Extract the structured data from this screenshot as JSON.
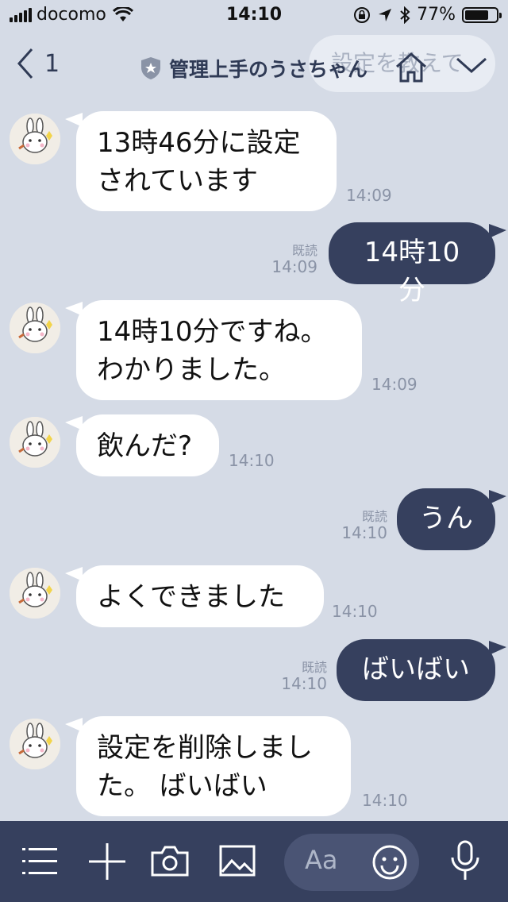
{
  "status_bar": {
    "carrier": "docomo",
    "time": "14:10",
    "battery_percent": "77%",
    "battery_level": 0.77
  },
  "header": {
    "back_count": "1",
    "title": "管理上手のうさちゃん",
    "ghost_text": "設定を教えて"
  },
  "messages": [
    {
      "side": "in",
      "text_lines": [
        "13時46分に設定",
        "されています"
      ],
      "time": "14:09"
    },
    {
      "side": "out",
      "text": "14時10分",
      "read": "既読",
      "time": "14:09"
    },
    {
      "side": "in",
      "text_lines": [
        "14時10分ですね。",
        "わかりました。"
      ],
      "time": "14:09"
    },
    {
      "side": "in",
      "text": "飲んだ?",
      "time": "14:10"
    },
    {
      "side": "out",
      "text": "うん",
      "read": "既読",
      "time": "14:10"
    },
    {
      "side": "in",
      "text": "よくできました",
      "time": "14:10"
    },
    {
      "side": "out",
      "text": "ばいばい",
      "read": "既読",
      "time": "14:10"
    },
    {
      "side": "in",
      "text_lines": [
        "設定を削除しまし",
        "た。 ばいばい"
      ],
      "time": "14:10"
    }
  ],
  "composer": {
    "placeholder": "Aa",
    "icons": [
      "menu-icon",
      "plus-icon",
      "camera-icon",
      "image-icon",
      "emoji-icon",
      "microphone-icon"
    ]
  },
  "colors": {
    "background": "#d5dbe6",
    "outgoing_bubble": "#36405e",
    "incoming_bubble": "#ffffff",
    "bottom_bar": "#36405e"
  }
}
